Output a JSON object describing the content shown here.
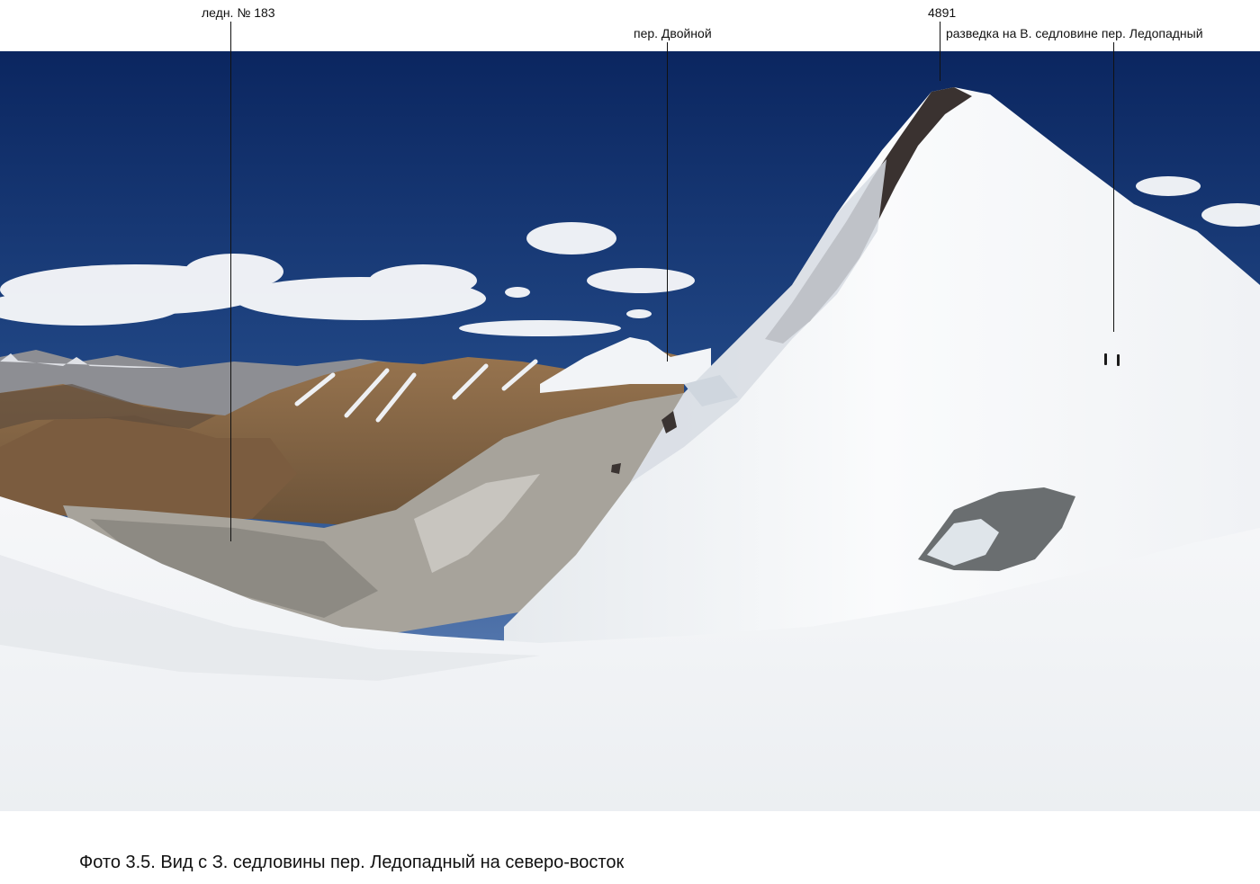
{
  "labels": {
    "glacier": "ледн. № 183",
    "pass_double": "пер. Двойной",
    "peak": "4891",
    "recon": "разведка на В. седловине пер. Ледопадный"
  },
  "caption": "Фото 3.5. Вид с З. седловины пер. Ледопадный на северо-восток",
  "colors": {
    "sky_top": "#0d2a63",
    "sky_bottom": "#6a8cc0",
    "snow": "#f4f6f8",
    "rock_brown": "#8a6a46",
    "ice_grey": "#9c9890"
  }
}
